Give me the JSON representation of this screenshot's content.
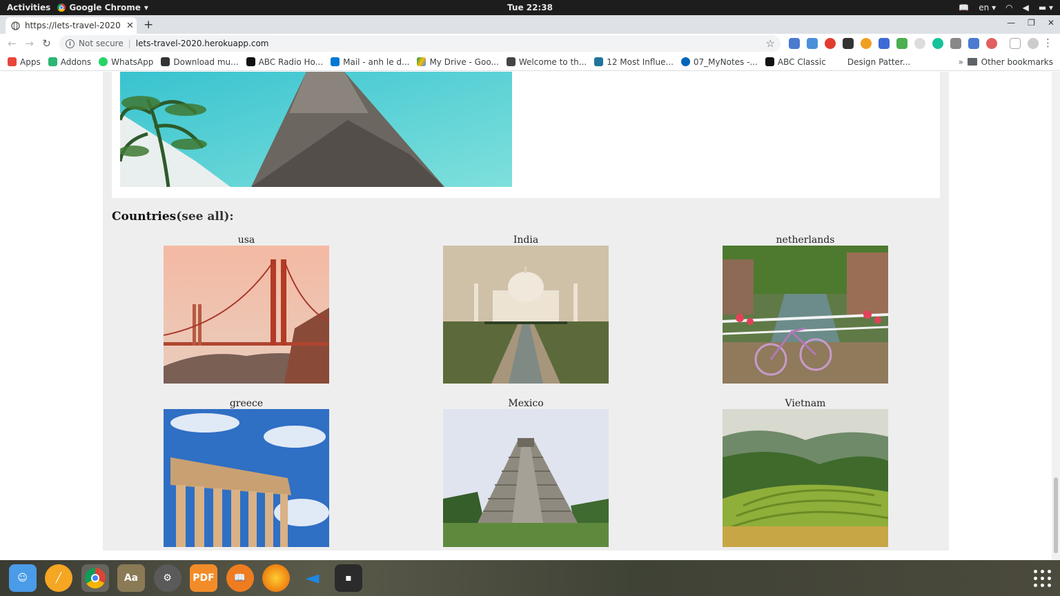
{
  "topbar": {
    "activities": "Activities",
    "app_name": "Google Chrome",
    "clock": "Tue 22:38",
    "lang": "en"
  },
  "browser": {
    "tab_title": "https://lets-travel-2020.herokuapp.com",
    "tab_title_visible": "https://lets-travel-2020.h",
    "security": "Not secure",
    "url": "lets-travel-2020.herokuapp.com"
  },
  "bookmarks": [
    {
      "label": "Apps",
      "color": "#e8453c"
    },
    {
      "label": "Addons",
      "color": "#2bb673"
    },
    {
      "label": "WhatsApp",
      "color": "#25d366"
    },
    {
      "label": "Download mu...",
      "color": "#333333"
    },
    {
      "label": "ABC Radio Ho...",
      "color": "#111111"
    },
    {
      "label": "Mail - anh le d...",
      "color": "#0078d4"
    },
    {
      "label": "My Drive - Goo...",
      "color": "#fbbc04"
    },
    {
      "label": "Welcome to th...",
      "color": "#444444"
    },
    {
      "label": "12 Most Influe...",
      "color": "#21759b"
    },
    {
      "label": "07_MyNotes -...",
      "color": "#0364b8"
    },
    {
      "label": "ABC Classic",
      "color": "#111111"
    },
    {
      "label": "Design Patter...",
      "color": "#ffffff"
    }
  ],
  "bookmarks_other": "Other bookmarks",
  "page": {
    "countries_heading": "Countries",
    "see_all": "(see all):",
    "countries": [
      {
        "name": "usa",
        "image": "golden-gate-bridge"
      },
      {
        "name": "India",
        "image": "taj-mahal"
      },
      {
        "name": "netherlands",
        "image": "canal-with-bicycle"
      },
      {
        "name": "greece",
        "image": "parthenon"
      },
      {
        "name": "Mexico",
        "image": "chichen-itza-pyramid"
      },
      {
        "name": "Vietnam",
        "image": "rice-terraces"
      }
    ]
  },
  "dock": [
    {
      "name": "finder-icon",
      "color": "#3a8ee6"
    },
    {
      "name": "sublime-icon",
      "color": "#f5a623"
    },
    {
      "name": "chrome-icon",
      "color": "#db4437"
    },
    {
      "name": "dictionary-icon",
      "color": "#8a7a55"
    },
    {
      "name": "settings-icon",
      "color": "#6a6a6a"
    },
    {
      "name": "pdf-icon",
      "color": "#f28c28"
    },
    {
      "name": "books-icon",
      "color": "#f07c20"
    },
    {
      "name": "firefox-icon",
      "color": "#e66000"
    },
    {
      "name": "vscode-icon",
      "color": "#0078d4"
    },
    {
      "name": "terminal-icon",
      "color": "#2b2b2b"
    }
  ]
}
